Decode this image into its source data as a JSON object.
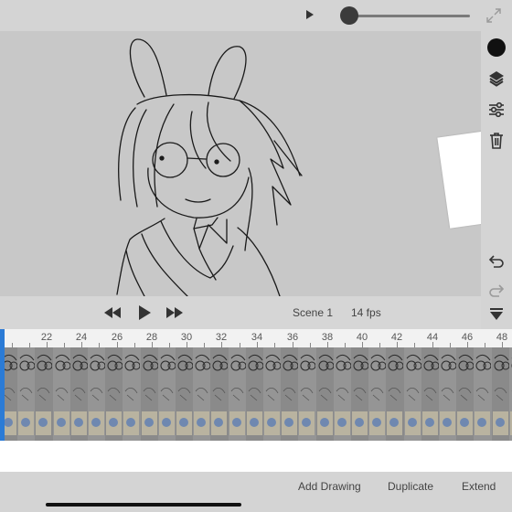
{
  "app": {
    "accent_color": "#2b7bd6"
  },
  "top_bar": {
    "play_icon": "play-icon",
    "brush_size_value": 0.05,
    "expand_icon": "expand-icon"
  },
  "tools": {
    "color_swatch": "#111111",
    "items": [
      "layers-icon",
      "adjustments-icon",
      "trash-icon",
      "undo-icon",
      "redo-icon",
      "collapse-icon"
    ]
  },
  "playback": {
    "rewind_icon": "rewind-icon",
    "play_icon": "play-icon",
    "forward_icon": "fast-forward-icon",
    "scene_label": "Scene 1",
    "fps_label": "14 fps"
  },
  "timeline": {
    "frame_numbers": [
      "22",
      "24",
      "26",
      "28",
      "30",
      "32",
      "34",
      "36",
      "38",
      "40",
      "42",
      "44",
      "46",
      "48"
    ]
  },
  "bottom_bar": {
    "add_drawing_label": "Add Drawing",
    "duplicate_label": "Duplicate",
    "extend_label": "Extend"
  }
}
